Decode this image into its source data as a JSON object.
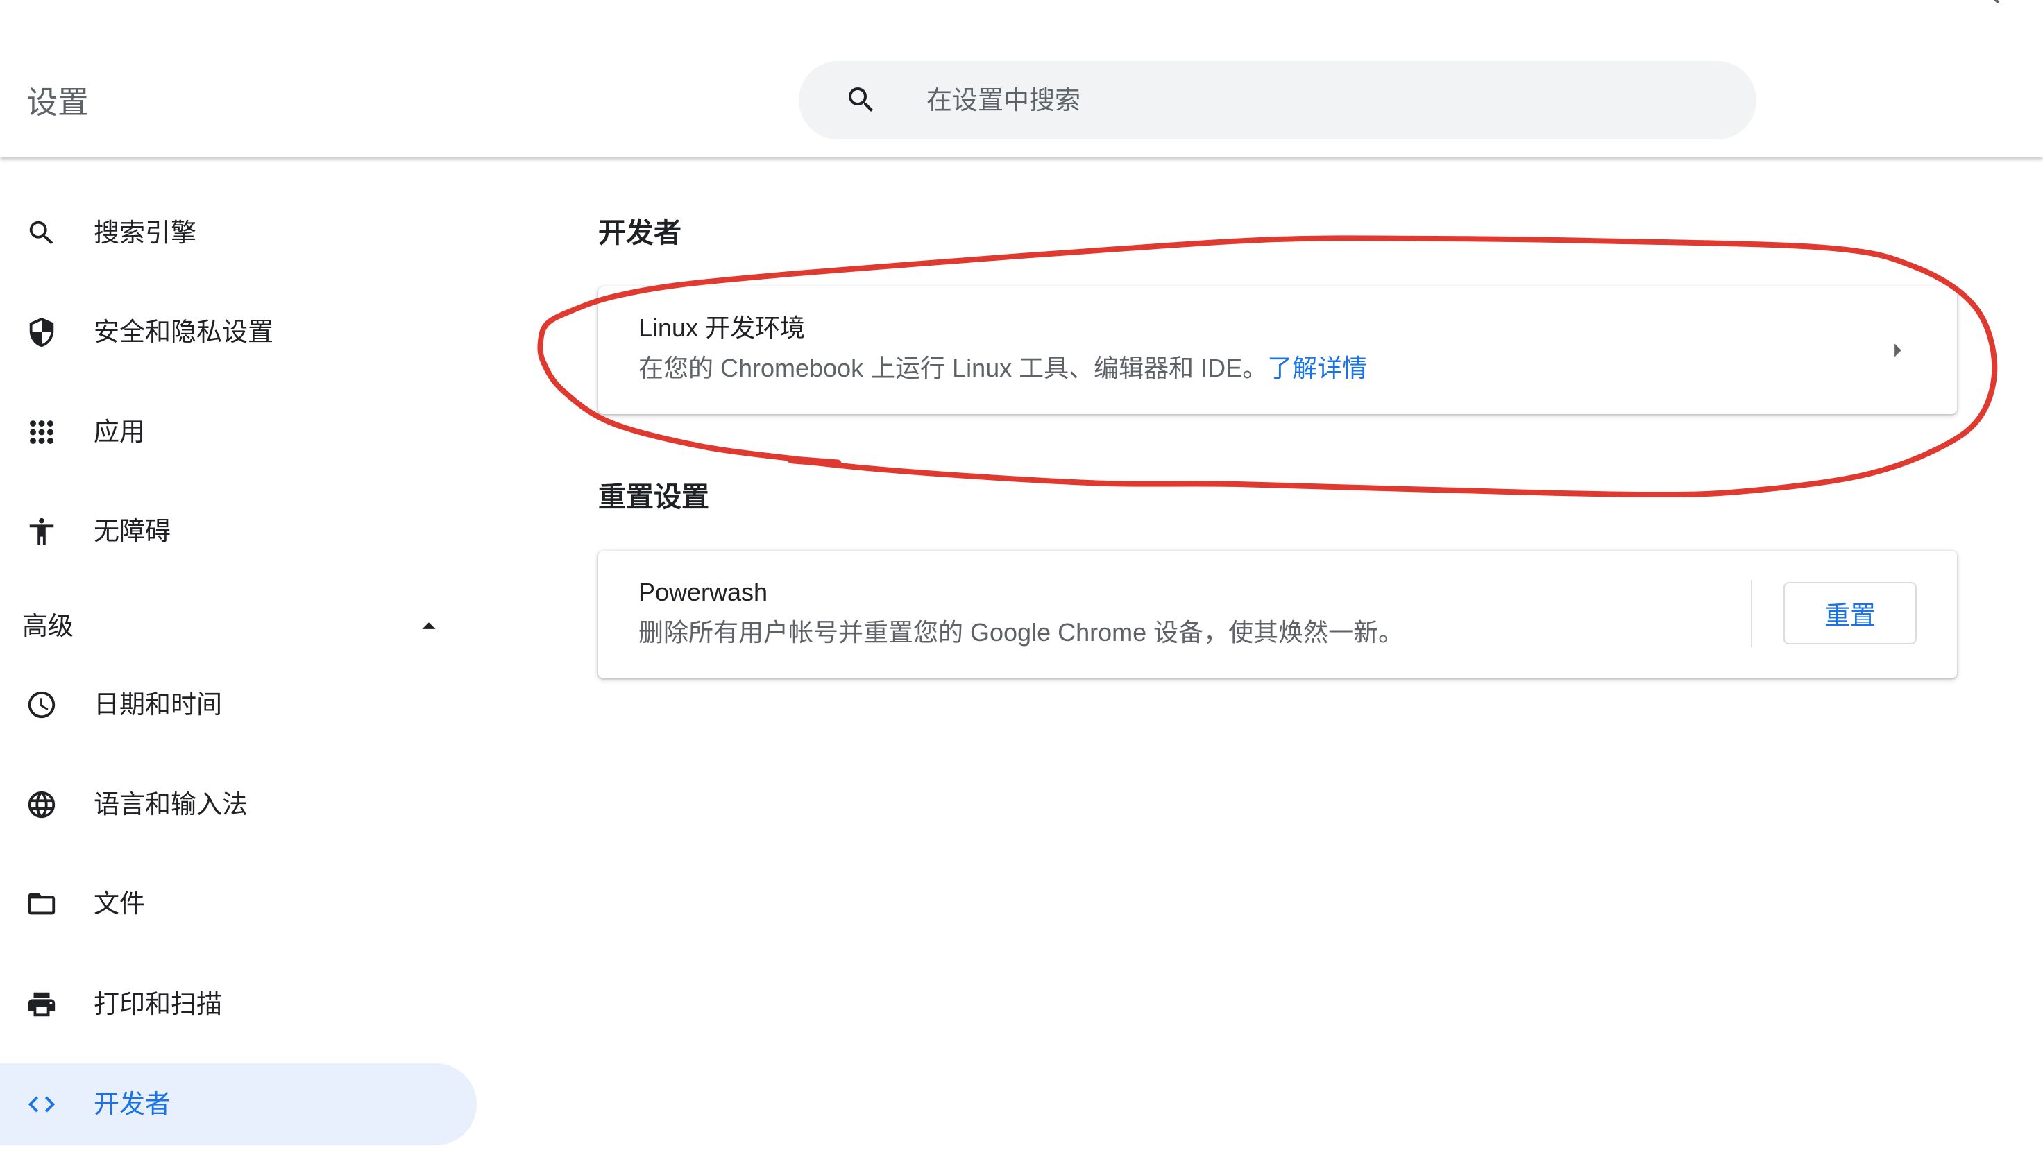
{
  "header": {
    "title": "设置",
    "search": {
      "placeholder": "在设置中搜索",
      "value": "",
      "icon": "search-icon"
    },
    "corner_icon": "search-icon"
  },
  "sidebar": {
    "items": [
      {
        "label": "搜索引擎",
        "icon": "search-icon",
        "selected": false
      },
      {
        "label": "安全和隐私设置",
        "icon": "shield-icon",
        "selected": false
      },
      {
        "label": "应用",
        "icon": "apps-icon",
        "selected": false
      },
      {
        "label": "无障碍",
        "icon": "accessibility-icon",
        "selected": false
      }
    ],
    "advanced": {
      "label": "高级",
      "expanded": true,
      "icon": "arrow-drop-up-icon",
      "items": [
        {
          "label": "日期和时间",
          "icon": "clock-icon",
          "selected": false
        },
        {
          "label": "语言和输入法",
          "icon": "globe-icon",
          "selected": false
        },
        {
          "label": "文件",
          "icon": "folder-icon",
          "selected": false
        },
        {
          "label": "打印和扫描",
          "icon": "print-icon",
          "selected": false
        },
        {
          "label": "开发者",
          "icon": "code-icon",
          "selected": true
        }
      ]
    }
  },
  "main": {
    "developer": {
      "heading": "开发者",
      "linux": {
        "title": "Linux 开发环境",
        "description": "在您的 Chromebook 上运行 Linux 工具、编辑器和 IDE。",
        "link": "了解详情",
        "icon": "arrow-right-icon"
      }
    },
    "reset": {
      "heading": "重置设置",
      "powerwash": {
        "title": "Powerwash",
        "description": "删除所有用户帐号并重置您的 Google Chrome 设备，使其焕然一新。",
        "button": "重置"
      }
    }
  },
  "colors": {
    "accent": "#1a73e8",
    "selected_bg": "#e8f0fe",
    "text_primary": "#202124",
    "text_secondary": "#5f6368",
    "search_bg": "#f1f3f4",
    "icon": "#202124",
    "divider": "#e0e0e0",
    "border": "#dadce0",
    "annotation": "#e0392f"
  }
}
